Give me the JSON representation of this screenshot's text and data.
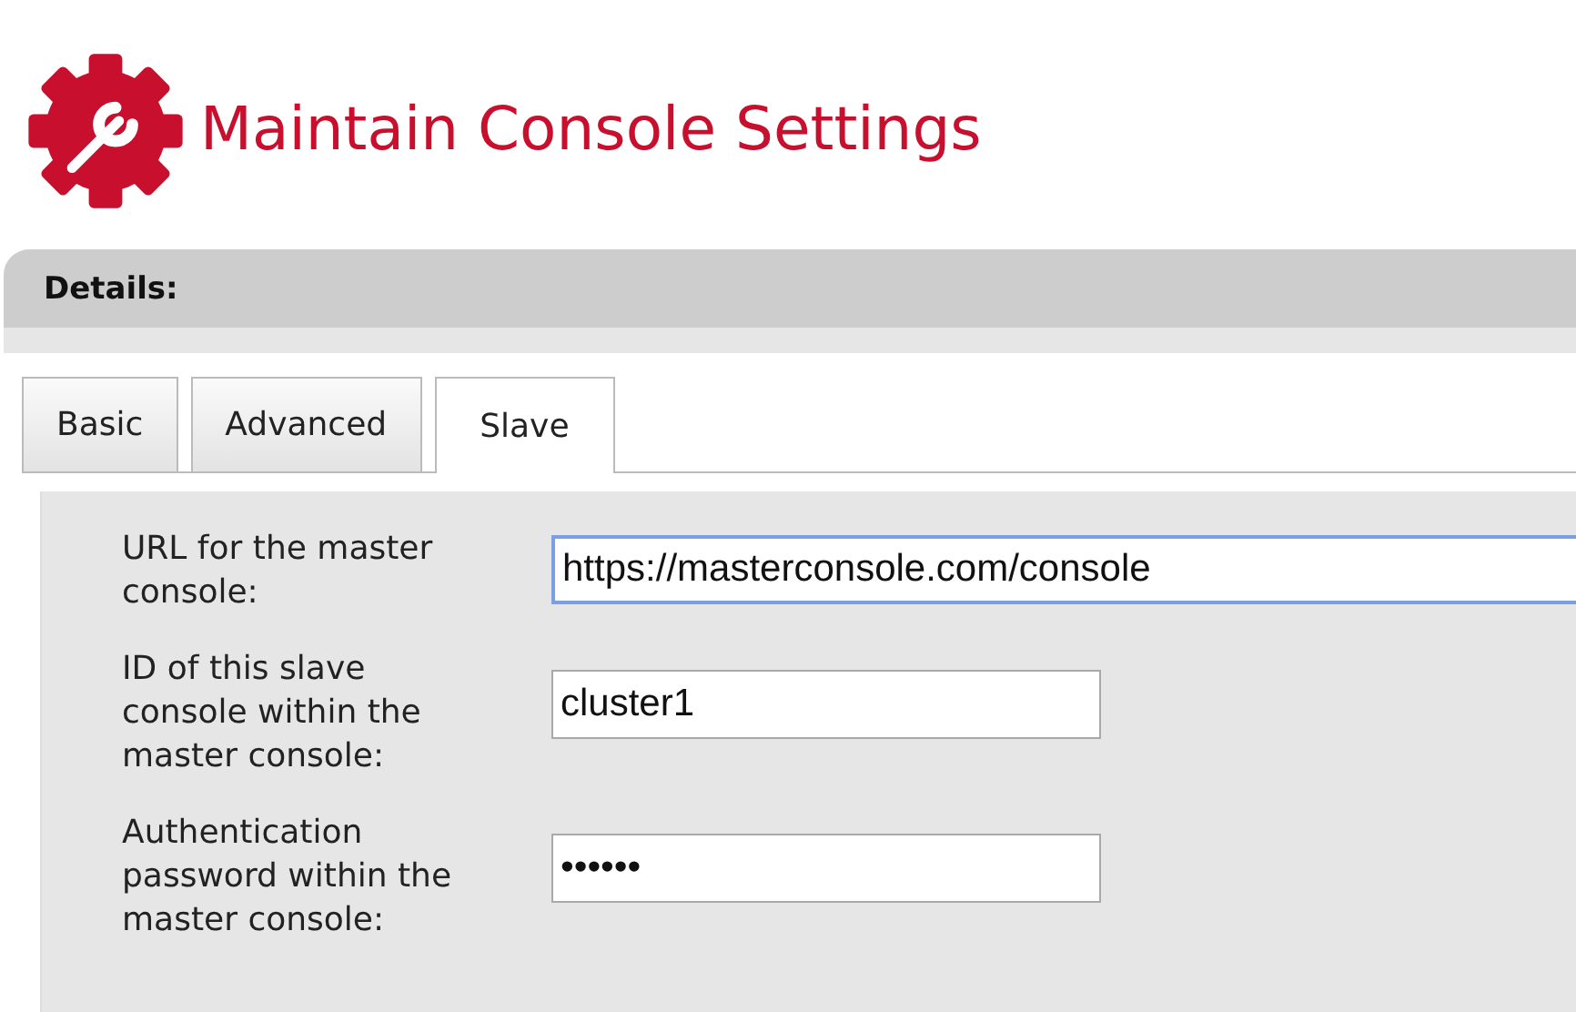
{
  "title": "Maintain Console Settings",
  "section": {
    "title": "Details:"
  },
  "tabs": [
    {
      "label": "Basic",
      "selected": false
    },
    {
      "label": "Advanced",
      "selected": false
    },
    {
      "label": "Slave",
      "selected": true
    }
  ],
  "fields": [
    {
      "label": "URL for the master console:",
      "value": "https://masterconsole.com/console",
      "focused": true,
      "wide": true
    },
    {
      "label": "ID of this slave console within the master console:",
      "value": "cluster1",
      "focused": false,
      "wide": false
    },
    {
      "label": "Authentication password within the master console:",
      "value": "••••••",
      "focused": false,
      "wide": false
    }
  ]
}
